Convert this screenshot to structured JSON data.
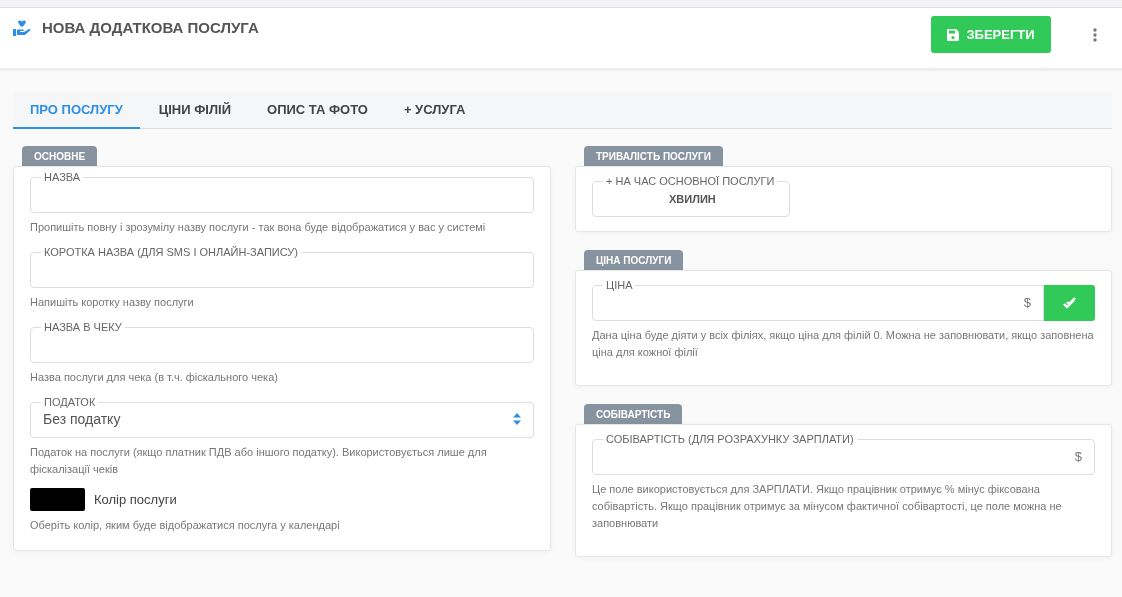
{
  "header": {
    "title": "НОВА ДОДАТКОВА ПОСЛУГА",
    "save_button": "ЗБЕРЕГТИ"
  },
  "tabs": [
    {
      "label": "ПРО ПОСЛУГУ",
      "selected": true
    },
    {
      "label": "ЦІНИ ФІЛІЙ",
      "selected": false
    },
    {
      "label": "ОПИС ТА ФОТО",
      "selected": false
    },
    {
      "label": "+ УСЛУГА",
      "selected": false
    }
  ],
  "main_section": {
    "title": "ОСНОВНЕ",
    "fields": [
      {
        "kind": "text",
        "label": "НАЗВА",
        "hint": "Пропишіть повну і зрозумілу назву послуги - так вона буде відображатися у вас у системі"
      },
      {
        "kind": "text",
        "label": "КОРОТКА НАЗВА (ДЛЯ SMS І ОНЛАЙН-ЗАПИСУ)",
        "hint": "Напишіть коротку назву послуги"
      },
      {
        "kind": "text",
        "label": "НАЗВА В ЧЕКУ",
        "hint": "Назва послуги для чека (в т.ч. фіскального чека)"
      },
      {
        "kind": "select",
        "label": "ПОДАТОК",
        "value": "Без податку",
        "hint": "Податок на послуги (якщо платник ПДВ або іншого податку). Використовується лише для фіскалізації чеків"
      },
      {
        "kind": "color",
        "label": "Колір послуги",
        "color": "#000000",
        "hint": "Оберіть колір, яким буде відображатися послуга у календарі"
      }
    ]
  },
  "duration_section": {
    "title": "ТРИВАЛІСТЬ ПОСЛУГИ",
    "field": {
      "label": "+ НА ЧАС ОСНОВНОЇ ПОСЛУГИ",
      "suffix": "ХВИЛИН"
    }
  },
  "price_section": {
    "title": "ЦІНА ПОСЛУГИ",
    "field": {
      "label": "ЦІНА",
      "suffix": "$"
    },
    "hint": "Дана ціна буде діяти у всіх філіях, якщо ціна для філій 0. Можна не заповнювати, якщо заповнена ціна для кожної філії"
  },
  "cost_section": {
    "title": "СОБІВАРТІСТЬ",
    "field": {
      "label": "СОБІВАРТІСТЬ (ДЛЯ РОЗРАХУНКУ ЗАРПЛАТИ)",
      "suffix": "$"
    },
    "hint": "Це поле використовується для ЗАРПЛАТИ. Якщо працівник отримує % мінус фіксована собівартість. Якщо працівник отримує за мінусом фактичної собівартості, це поле можна не заповнювати"
  }
}
